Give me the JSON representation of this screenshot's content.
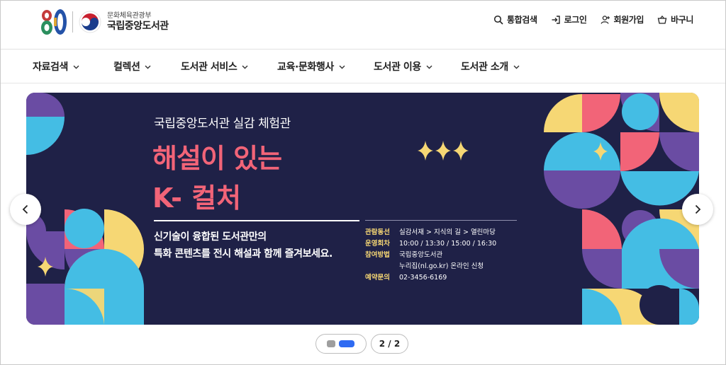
{
  "header": {
    "logo_number": "80",
    "ministry": "문화체육관광부",
    "library_name": "국립중앙도서관",
    "util": [
      {
        "label": "통합검색",
        "icon": "search-icon"
      },
      {
        "label": "로그인",
        "icon": "login-icon"
      },
      {
        "label": "회원가입",
        "icon": "user-plus-icon"
      },
      {
        "label": "바구니",
        "icon": "basket-icon"
      }
    ]
  },
  "gnb": [
    {
      "label": "자료검색"
    },
    {
      "label": "컬렉션"
    },
    {
      "label": "도서관 서비스"
    },
    {
      "label": "교육·문화행사"
    },
    {
      "label": "도서관 이용"
    },
    {
      "label": "도서관 소개"
    }
  ],
  "banner": {
    "subtitle": "국립중앙도서관 실감 체험관",
    "title_line1": "해설이 있는",
    "title_line2": "K- 컬처",
    "desc_line1": "신기술이 융합된 도서관만의",
    "desc_line2": "특화 콘텐츠를 전시 해설과 함께 즐겨보세요.",
    "info": {
      "route_label": "관람동선",
      "route_value": "실감서재 > 지식의 길 > 열린마당",
      "times_label": "운영회차",
      "times_value": "10:00 / 13:30 / 15:00 / 16:30",
      "apply_label": "참여방법",
      "apply_value1": "국립중앙도서관",
      "apply_value2": "누리집(nl.go.kr) 온라인 신청",
      "contact_label": "예약문의",
      "contact_value": "02-3456-6169"
    },
    "colors": {
      "background": "#1f2147",
      "title": "#f26478",
      "label": "#f6d774"
    }
  },
  "carousel": {
    "counter": "2 / 2",
    "active_slide": 2,
    "total_slides": 2
  }
}
